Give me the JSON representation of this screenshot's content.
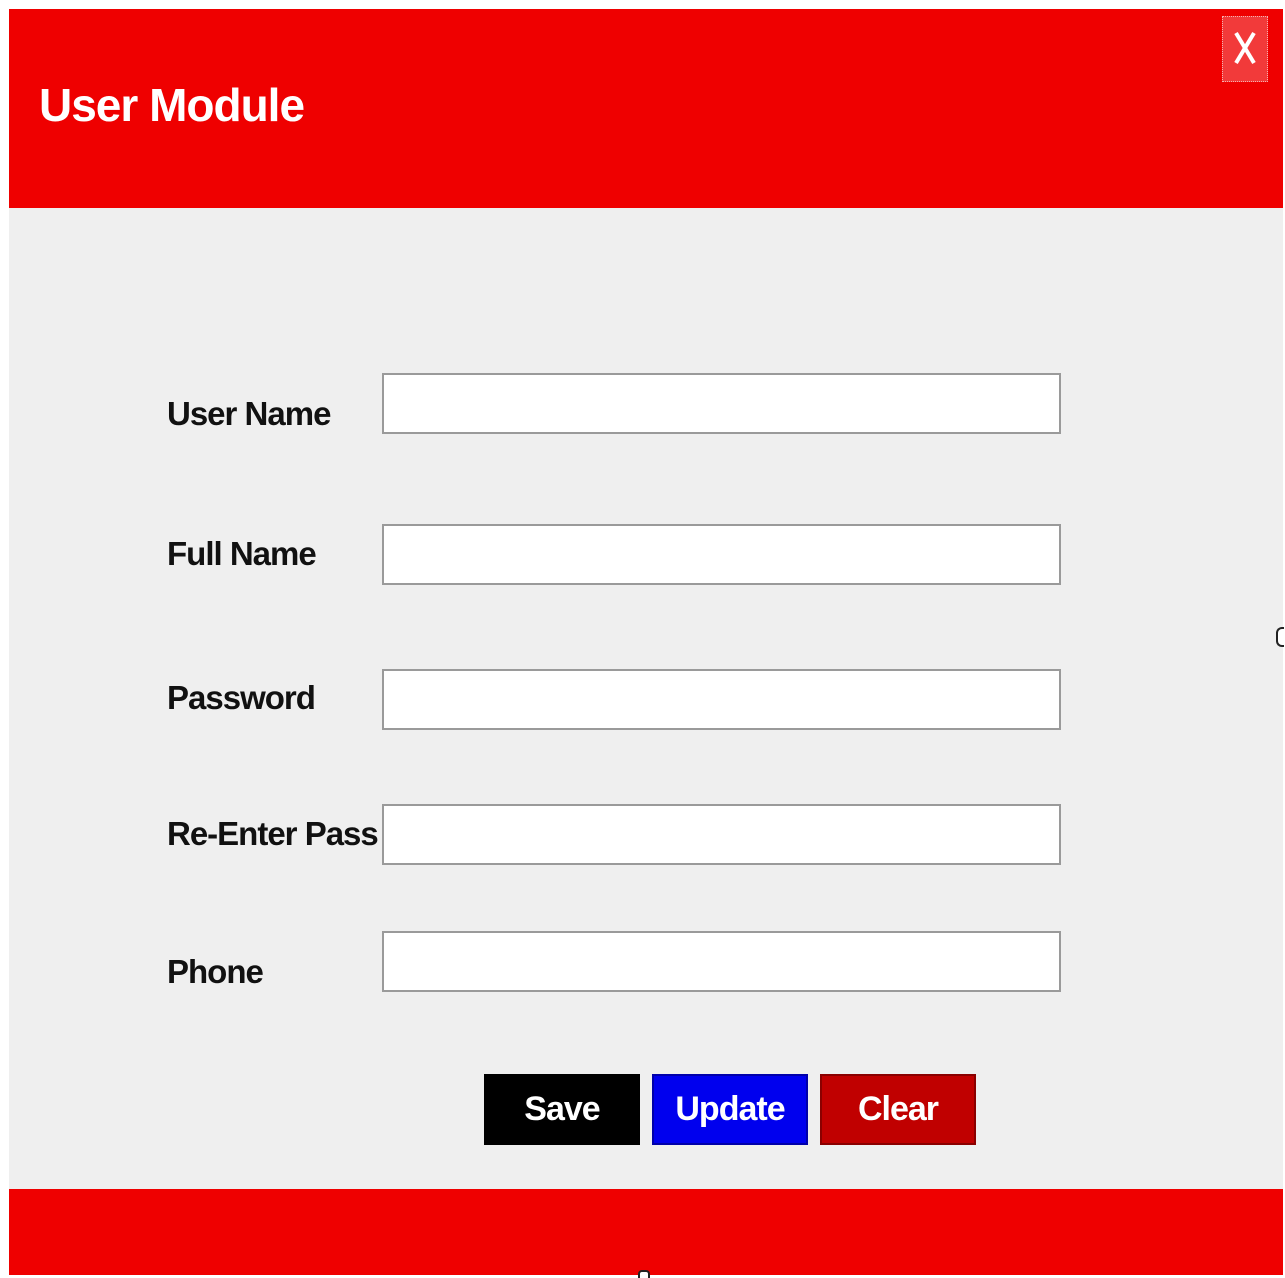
{
  "window": {
    "title": "User Module",
    "close_label": "X",
    "header_color": "#ef0000",
    "footer_color": "#ef0000",
    "body_color": "#efefef"
  },
  "form": {
    "fields": [
      {
        "label": "User Name",
        "value": "",
        "placeholder": ""
      },
      {
        "label": "Full Name",
        "value": "",
        "placeholder": ""
      },
      {
        "label": "Password",
        "value": "",
        "placeholder": ""
      },
      {
        "label": "Re-Enter Pass",
        "value": "",
        "placeholder": ""
      },
      {
        "label": "Phone",
        "value": "",
        "placeholder": ""
      }
    ]
  },
  "buttons": {
    "save_label": "Save",
    "update_label": "Update",
    "clear_label": "Clear",
    "save_color": "#000000",
    "update_color": "#0000ee",
    "clear_color": "#c00000"
  }
}
